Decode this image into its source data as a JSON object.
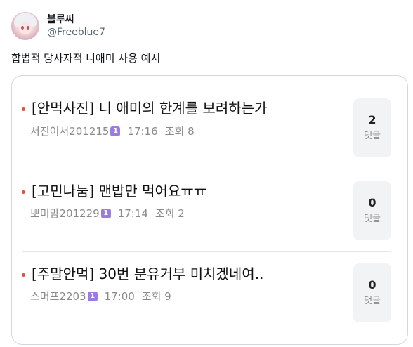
{
  "user": {
    "display_name": "블루씨",
    "handle": "@Freeblue7"
  },
  "tweet": {
    "text": "합법적 당사자적 니애미 사용 예시"
  },
  "posts": [
    {
      "title": "[안먹사진] 니 애미의 한계를 보려하는가",
      "author": "서진이서201215",
      "badge": "1",
      "time": "17:16",
      "views": "조회 8",
      "comments": "2",
      "comments_label": "댓글"
    },
    {
      "title": "[고민나눔] 맨밥만 먹어요ㅠㅠ",
      "author": "뽀미맘201229",
      "badge": "1",
      "time": "17:14",
      "views": "조회 2",
      "comments": "0",
      "comments_label": "댓글"
    },
    {
      "title": "[주말안먹] 30번 분유거부 미치겠네여..",
      "author": "스머프2203",
      "badge": "1",
      "time": "17:00",
      "views": "조회 9",
      "comments": "0",
      "comments_label": "댓글"
    }
  ],
  "colors": {
    "bullet": "#e74c3c",
    "badge": "#9b7be0",
    "handle": "#536471"
  }
}
